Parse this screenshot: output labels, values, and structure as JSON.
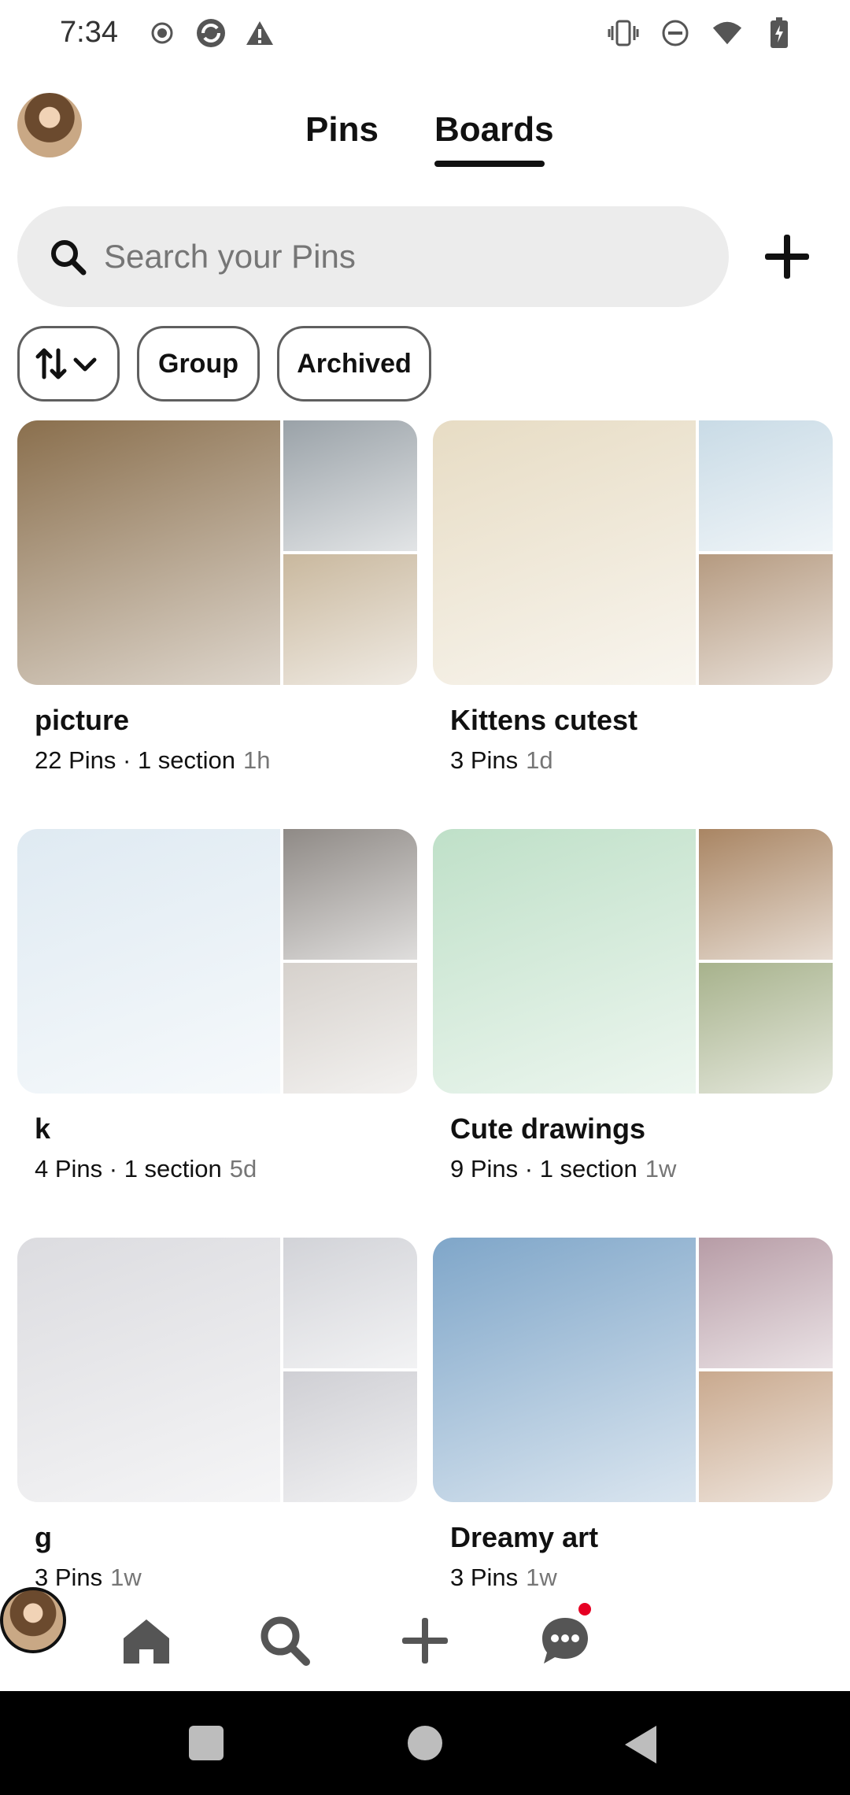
{
  "status_bar": {
    "time": "7:34"
  },
  "header": {
    "tabs": [
      {
        "label": "Pins"
      },
      {
        "label": "Boards"
      }
    ],
    "active_tab": "Boards"
  },
  "search": {
    "placeholder": "Search your Pins"
  },
  "filters": {
    "group_label": "Group",
    "archived_label": "Archived"
  },
  "boards": [
    {
      "name": "picture",
      "meta": "22 Pins · 1 section",
      "age": "1h",
      "colors": [
        "#8a6f4d",
        "#9aa2a8",
        "#c9b89e"
      ]
    },
    {
      "name": "Kittens cutest",
      "meta": "3 Pins",
      "age": "1d",
      "colors": [
        "#e7dcc4",
        "#c9dbe6",
        "#b59a80"
      ]
    },
    {
      "name": "k",
      "meta": "4 Pins · 1 section",
      "age": "5d",
      "colors": [
        "#dfeaf2",
        "#8f8a86",
        "#d6d1cc"
      ]
    },
    {
      "name": "Cute drawings",
      "meta": "9 Pins · 1 section",
      "age": "1w",
      "colors": [
        "#bfe0c8",
        "#a98563",
        "#a7b28c"
      ]
    },
    {
      "name": "g",
      "meta": "3 Pins",
      "age": "1w",
      "colors": [
        "#dcdce0",
        "#d2d3d8",
        "#cfcfd4"
      ]
    },
    {
      "name": "Dreamy art",
      "meta": "3 Pins",
      "age": "1w",
      "colors": [
        "#7fa6c9",
        "#b79ca6",
        "#c9a98e"
      ]
    }
  ],
  "colors": {
    "accent": "#111111",
    "notification": "#e60023",
    "search_bg": "#ececec"
  }
}
